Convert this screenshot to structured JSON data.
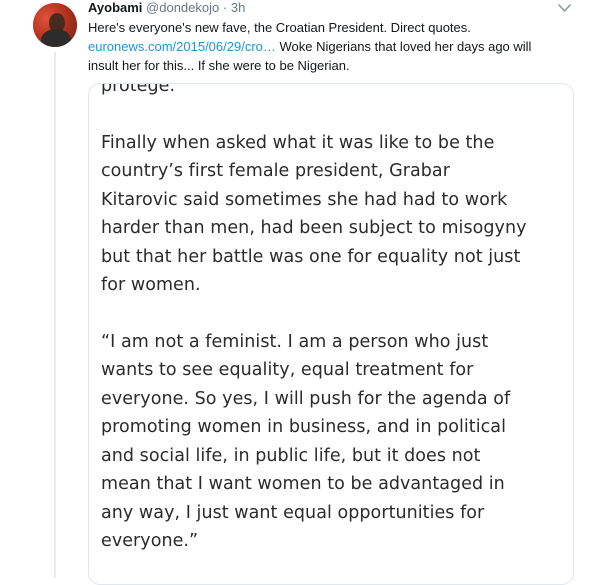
{
  "tweet": {
    "author_name": "Ayobami",
    "author_handle": "@dondekojo",
    "separator": "·",
    "time": "3h",
    "text_line1": "Here's everyone's new fave, the Croatian President. Direct quotes.",
    "link_text": "euronews.com/2015/06/29/cro…",
    "text_line2_rest": " Woke Nigerians that loved her days ago will",
    "text_line3": "insult her for this... If she were to be Nigerian."
  },
  "card": {
    "cutoff_line": "— — — — — — — — — —   ·   — — —",
    "para0": [
      "protégé.”"
    ],
    "para1": [
      "Finally when asked what it was like to be the",
      "country’s first female president, Grabar",
      "Kitarovic said sometimes she had had to work",
      "harder than men, had been subject to misogyny",
      "but that her battle was one for equality not just",
      "for women."
    ],
    "para2": [
      "“I am not a feminist. I am a person who just",
      "wants to see equality, equal treatment for",
      "everyone. So yes, I will push for the agenda of",
      "promoting women in business, and in political",
      "and social life, in public life, but it does not",
      "mean that I want women to be advantaged in",
      "any way, I just want equal opportunities for",
      "everyone.”"
    ]
  },
  "icons": {
    "caret": "chevron-down-icon",
    "avatar": "avatar"
  }
}
